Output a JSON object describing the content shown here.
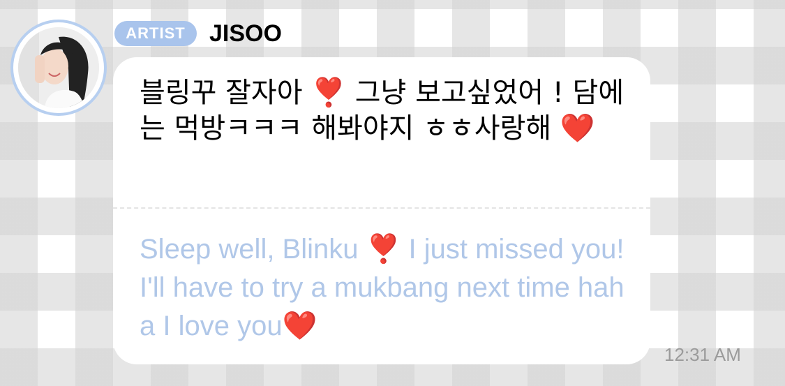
{
  "message": {
    "badge_label": "ARTIST",
    "sender_name": "JISOO",
    "original_text": "블링꾸 잘자아 ❣️ 그냥 보고싶었어 ! 담에는 먹방ㅋㅋㅋ 해봐야지 ㅎㅎ사랑해 ❤️",
    "translated_text": "Sleep well, Blinku ❣️ I just missed you! I'll have to try a mukbang next time haha I love you❤️",
    "timestamp": "12:31 AM"
  },
  "colors": {
    "badge_bg": "#a9c4ec",
    "avatar_ring": "#b7cff0",
    "translation_text": "#b0c7e8",
    "timestamp_text": "#9b9b9b"
  }
}
